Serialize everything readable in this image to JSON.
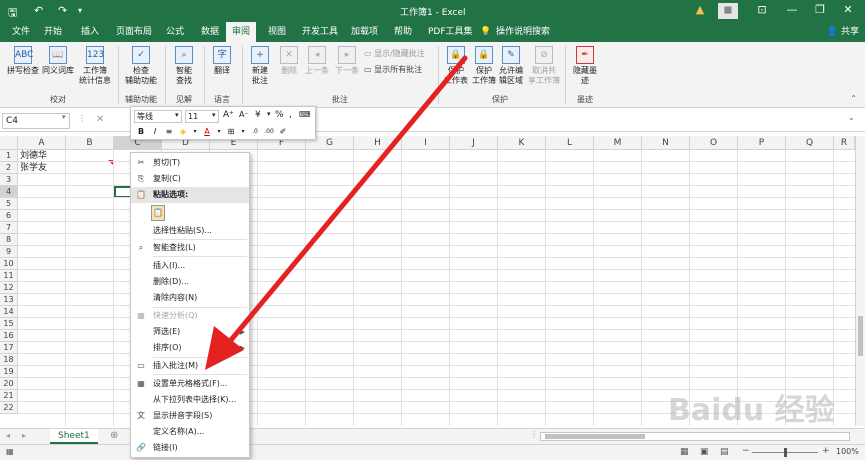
{
  "colors": {
    "excel_green": "#217346",
    "arrow_red": "#e52222"
  },
  "titlebar": {
    "title": "工作簿1 - Excel",
    "qat": [
      "save-icon",
      "undo-icon",
      "redo-icon",
      "customize-qat-icon"
    ],
    "share": "共享"
  },
  "tabs": [
    "文件",
    "开始",
    "插入",
    "页面布局",
    "公式",
    "数据",
    "审阅",
    "视图",
    "开发工具",
    "加载项",
    "帮助",
    "PDF工具集",
    "操作说明搜索"
  ],
  "active_tab": "审阅",
  "ribbon": {
    "proofing": {
      "spell": "拼写检查",
      "thesaurus": "同义词库",
      "stats_1": "工作簿",
      "stats_2": "统计信息",
      "label": "校对"
    },
    "accessibility": {
      "check_1": "检查",
      "check_2": "辅助功能",
      "label": "辅助功能"
    },
    "insights": {
      "smart_1": "智能",
      "smart_2": "查找",
      "label": "见解"
    },
    "language": {
      "translate": "翻译",
      "label": "语言"
    },
    "comments": {
      "new_1": "新建",
      "new_2": "批注",
      "delete": "删除",
      "prev": "上一条",
      "next": "下一条",
      "show_hide": "显示/隐藏批注",
      "show_all": "显示所有批注",
      "label": "批注"
    },
    "protect": {
      "sheet_1": "保护",
      "sheet_2": "工作表",
      "book_1": "保护",
      "book_2": "工作簿",
      "ranges_1": "允许编",
      "ranges_2": "辑区域",
      "unshare_1": "取消共",
      "unshare_2": "享工作簿",
      "label": "保护"
    },
    "ink": {
      "hide_1": "隐藏墨",
      "hide_2": "迹",
      "label": "墨迹"
    }
  },
  "formula_bar": {
    "name_box": "C4"
  },
  "columns": [
    "A",
    "B",
    "C",
    "D",
    "E",
    "F",
    "G",
    "H",
    "I",
    "J",
    "K",
    "L",
    "M",
    "N",
    "O",
    "P",
    "Q",
    "R"
  ],
  "rows": [
    "1",
    "2",
    "3",
    "4",
    "5",
    "6",
    "7",
    "8",
    "9",
    "10",
    "11",
    "12",
    "13",
    "14",
    "15",
    "16",
    "17",
    "18",
    "19",
    "20",
    "21",
    "22"
  ],
  "cells": {
    "a1": "刘德华",
    "a2": "张学友"
  },
  "mini_toolbar": {
    "font": "等线",
    "size": "11"
  },
  "context_menu": {
    "cut": "剪切(T)",
    "copy": "复制(C)",
    "paste_options": "粘贴选项:",
    "paste_special": "选择性粘贴(S)...",
    "smart_lookup": "智能查找(L)",
    "insert": "插入(I)...",
    "delete": "删除(D)...",
    "clear": "清除内容(N)",
    "quick_analysis": "快速分析(Q)",
    "filter": "筛选(E)",
    "sort": "排序(O)",
    "insert_comment": "插入批注(M)",
    "format_cells": "设置单元格格式(F)...",
    "pick_list": "从下拉列表中选择(K)...",
    "phonetic": "显示拼音字段(S)",
    "define_name": "定义名称(A)...",
    "link": "链接(I)"
  },
  "sheet_tab": "Sheet1",
  "zoom": "100%",
  "watermark": "Baidu 经验"
}
